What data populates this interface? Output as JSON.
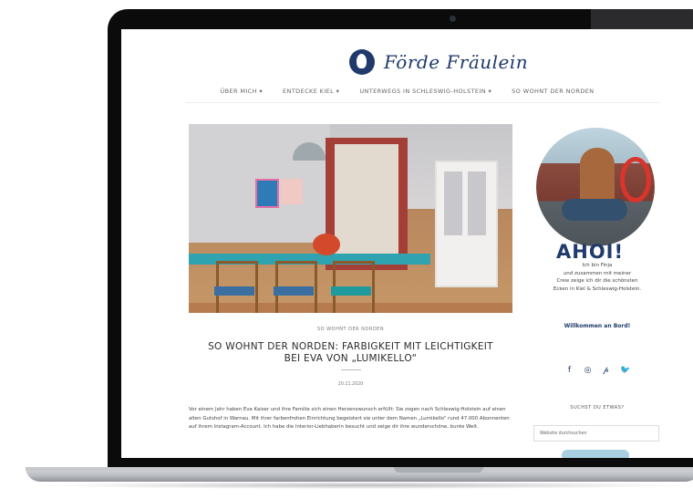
{
  "site": {
    "name": "Förde Fräulein",
    "nav": [
      "ÜBER MICH ▾",
      "ENTDECKE KIEL ▾",
      "UNTERWEGS IN SCHLESWIG-HOLSTEIN ▾",
      "SO WOHNT DER NORDEN"
    ]
  },
  "post": {
    "category": "SO WOHNT DER NORDEN",
    "title_line1": "SO WOHNT DER NORDEN: FARBIGKEIT MIT LEICHTIGKEIT",
    "title_line2": "BEI EVA VON „LUMIKELLO“",
    "date": "20.11.2020",
    "excerpt": "Vor einem Jahr haben Eva Kaiser und ihre Familie sich einen Herzenswunsch erfüllt: Sie zogen nach Schleswig-Holstein auf einen alten Gutshof in Warnau. Mit ihrer farbenfrohen Einrichtung begeistert sie unter dem Namen „Lumikello“ rund 47.000 Abonnenten auf ihrem Instagram-Account. Ich habe die Interior-Liebhaberin besucht und zeige dir ihre wunderschöne, bunte Welt."
  },
  "sidebar": {
    "greeting": "AHOI!",
    "intro": "Ich bin Finja\nund zusammen mit meiner\nCrew zeige ich dir die schönsten\nEcken in Kiel & Schleswig-Holstein.",
    "welcome": "Willkommen an Bord!",
    "social_icons": [
      "f",
      "◎",
      "𝓅",
      "🐦"
    ],
    "search_label": "SUCHST DU ETWAS?",
    "search_placeholder": "Website durchsuchen"
  }
}
